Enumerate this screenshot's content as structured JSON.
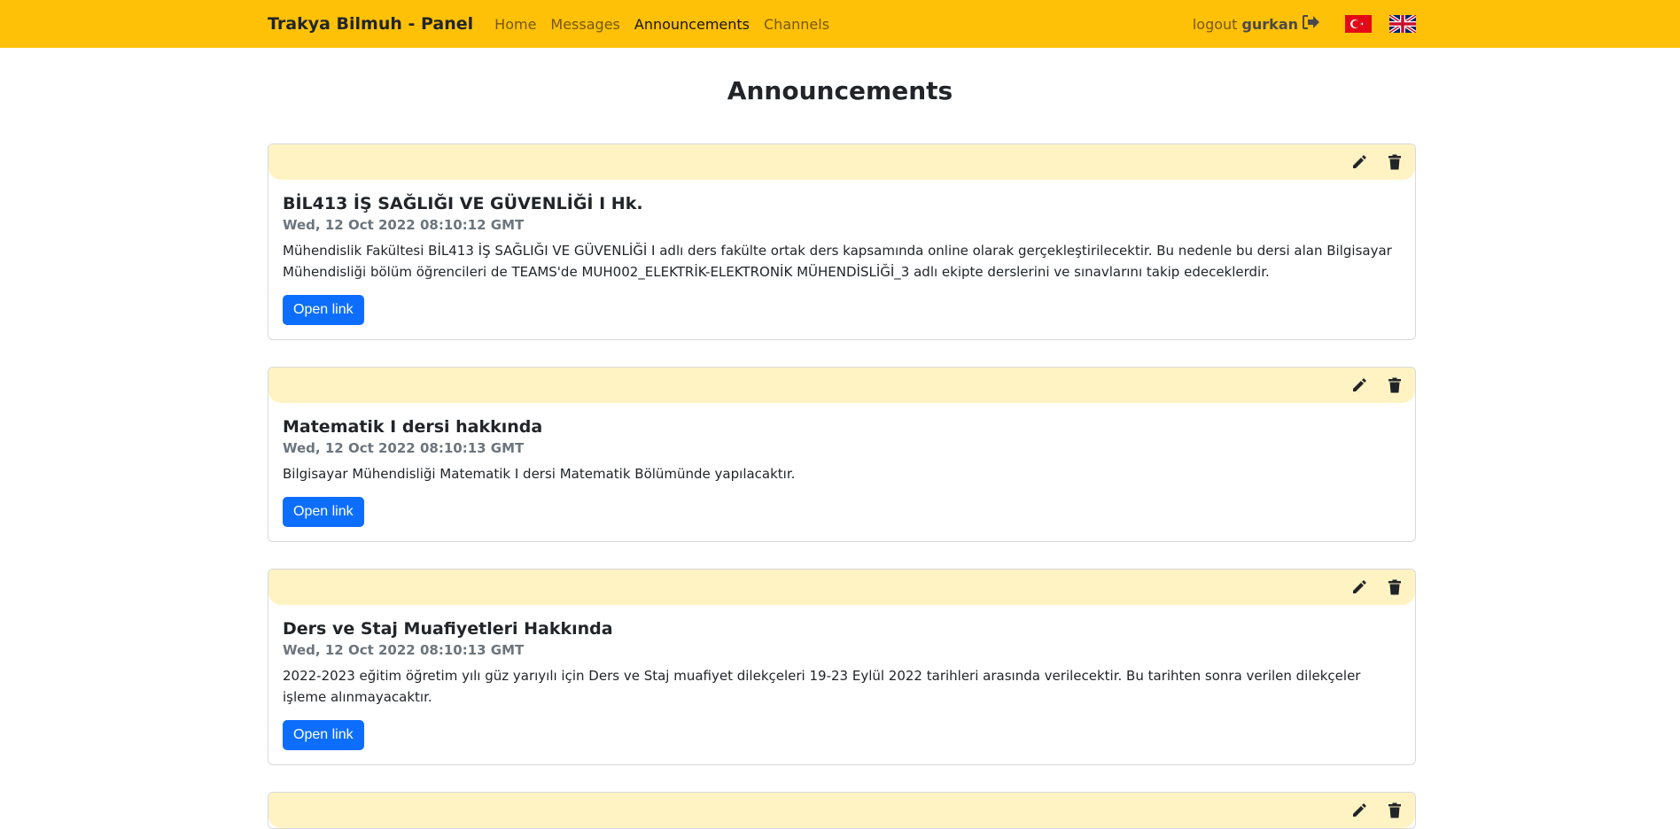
{
  "navbar": {
    "brand": "Trakya Bilmuh - Panel",
    "links": [
      "Home",
      "Messages",
      "Announcements",
      "Channels"
    ],
    "active": "Announcements",
    "logout_label": "logout",
    "username": "gurkan",
    "accent_color": "#ffc107"
  },
  "page": {
    "title": "Announcements"
  },
  "announcements": [
    {
      "title": "BİL413 İŞ SAĞLIĞI VE GÜVENLİĞİ I Hk.",
      "date": "Wed, 12 Oct 2022 08:10:12 GMT",
      "text": "Mühendislik Fakültesi BİL413 İŞ SAĞLIĞI VE GÜVENLİĞİ I adlı ders fakülte ortak ders kapsamında online olarak gerçekleştirilecektir. Bu nedenle bu dersi alan Bilgisayar Mühendisliği bölüm öğrencileri de TEAMS'de MUH002_ELEKTRİK-ELEKTRONİK MÜHENDİSLİĞİ_3 adlı ekipte derslerini ve sınavlarını takip edeceklerdir.",
      "button": "Open link"
    },
    {
      "title": "Matematik I dersi hakkında",
      "date": "Wed, 12 Oct 2022 08:10:13 GMT",
      "text": "Bilgisayar Mühendisliği Matematik I dersi Matematik Bölümünde yapılacaktır.",
      "button": "Open link"
    },
    {
      "title": "Ders ve Staj Muafiyetleri Hakkında",
      "date": "Wed, 12 Oct 2022 08:10:13 GMT",
      "text": "2022-2023 eğitim öğretim yılı güz yarıyılı için Ders ve Staj muafiyet dilekçeleri 19-23 Eylül 2022 tarihleri arasında verilecektir. Bu tarihten sonra verilen dilekçeler işleme alınmayacaktır.",
      "button": "Open link"
    }
  ]
}
